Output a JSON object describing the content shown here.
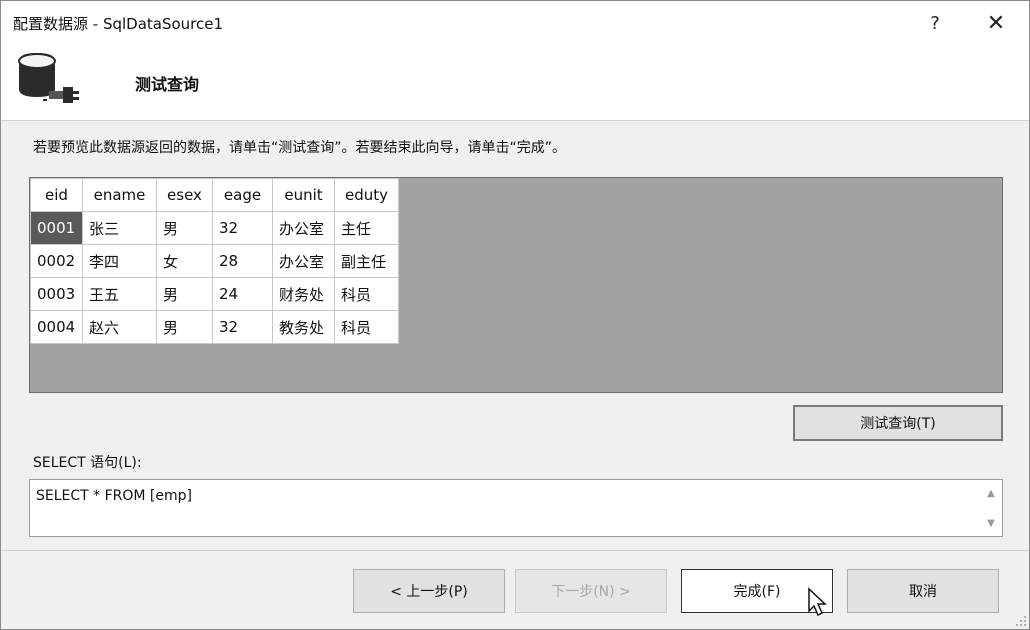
{
  "window": {
    "title": "配置数据源 - SqlDataSource1",
    "help_label": "?",
    "close_label": "✕"
  },
  "header": {
    "title": "测试查询",
    "icon": "database-connection-icon"
  },
  "instruction": "若要预览此数据源返回的数据，请单击“测试查询”。若要结束此向导，请单击“完成”。",
  "grid": {
    "columns": [
      "eid",
      "ename",
      "esex",
      "eage",
      "eunit",
      "eduty"
    ],
    "rows": [
      [
        "0001",
        "张三",
        "男",
        "32",
        "办公室",
        "主任"
      ],
      [
        "0002",
        "李四",
        "女",
        "28",
        "办公室",
        "副主任"
      ],
      [
        "0003",
        "王五",
        "男",
        "24",
        "财务处",
        "科员"
      ],
      [
        "0004",
        "赵六",
        "男",
        "32",
        "教务处",
        "科员"
      ]
    ],
    "selected_cell": "0001"
  },
  "test_query_button": "测试查询(T)",
  "select_statement": {
    "label": "SELECT 语句(L):",
    "value": "SELECT * FROM [emp]"
  },
  "footer": {
    "prev_label": "< 上一步(P)",
    "next_label": "下一步(N) >",
    "finish_label": "完成(F)",
    "cancel_label": "取消"
  },
  "colors": {
    "grid_background": "#a3a3a3",
    "selected_cell": "#5a5a5a",
    "dialog_background": "#f0f0f0"
  }
}
